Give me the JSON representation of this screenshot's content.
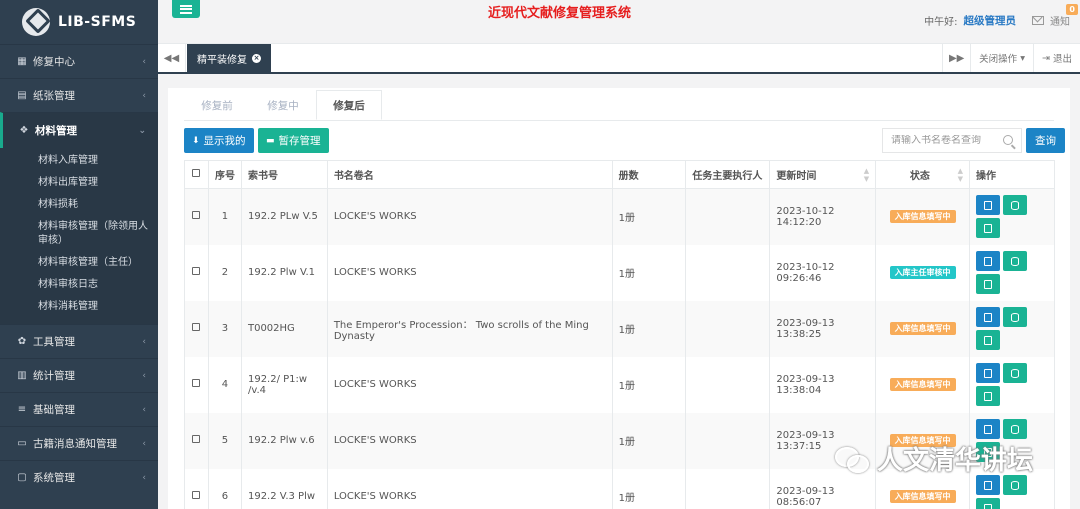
{
  "app": {
    "logo_text": "LIB-SFMS",
    "system_title": "近现代文献修复管理系统"
  },
  "header": {
    "greeting": "中午好:",
    "user_name": "超级管理员",
    "notify_label": "通知",
    "notify_count": "0"
  },
  "sidebar": {
    "items": [
      {
        "label": "修复中心",
        "icon": "briefcase-icon"
      },
      {
        "label": "纸张管理",
        "icon": "file-icon"
      },
      {
        "label": "材料管理",
        "icon": "cubes-icon",
        "active": true
      },
      {
        "label": "工具管理",
        "icon": "gear-icon"
      },
      {
        "label": "统计管理",
        "icon": "bar-chart-icon"
      },
      {
        "label": "基础管理",
        "icon": "list-icon"
      },
      {
        "label": "古籍消息通知管理",
        "icon": "laptop-icon"
      },
      {
        "label": "系统管理",
        "icon": "monitor-icon"
      }
    ],
    "sub_items": [
      "材料入库管理",
      "材料出库管理",
      "材料损耗",
      "材料审核管理（除领用人审核）",
      "材料审核管理（主任）",
      "材料审核日志",
      "材料消耗管理"
    ]
  },
  "tabbar": {
    "current_tab": "精平装修复",
    "close_ops": "关闭操作",
    "logout": "退出"
  },
  "subtabs": [
    "修复前",
    "修复中",
    "修复后"
  ],
  "toolbar": {
    "show_mine": "显示我的",
    "temp_manage": "暂存管理",
    "search_placeholder": "请输入书名卷名查询",
    "search_button": "查询"
  },
  "table": {
    "headers": [
      "序号",
      "索书号",
      "书名卷名",
      "册数",
      "任务主要执行人",
      "更新时间",
      "状态",
      "操作"
    ],
    "rows": [
      {
        "no": "1",
        "call": "192.2 PLw V.5",
        "title": "LOCKE'S WORKS",
        "vols": "1册",
        "exec": "",
        "date": "2023-10-12",
        "time": "14:12:20",
        "status": "入库信息填写中",
        "color": "orange"
      },
      {
        "no": "2",
        "call": "192.2 Plw V.1",
        "title": "LOCKE'S WORKS",
        "vols": "1册",
        "exec": "",
        "date": "2023-10-12",
        "time": "09:26:46",
        "status": "入库主任审核中",
        "color": "cyan"
      },
      {
        "no": "3",
        "call": "T0002HG",
        "title": "The Emperor's Procession： Two scrolls of the Ming Dynasty",
        "vols": "1册",
        "exec": "",
        "date": "2023-09-13",
        "time": "13:38:25",
        "status": "入库信息填写中",
        "color": "orange"
      },
      {
        "no": "4",
        "call": "192.2/ P1:w /v.4",
        "title": "LOCKE'S WORKS",
        "vols": "1册",
        "exec": "",
        "date": "2023-09-13",
        "time": "13:38:04",
        "status": "入库信息填写中",
        "color": "orange"
      },
      {
        "no": "5",
        "call": "192.2 Plw v.6",
        "title": "LOCKE'S WORKS",
        "vols": "1册",
        "exec": "",
        "date": "2023-09-13",
        "time": "13:37:15",
        "status": "入库信息填写中",
        "color": "orange"
      },
      {
        "no": "6",
        "call": "192.2 V.3 Plw",
        "title": "LOCKE'S WORKS",
        "vols": "1册",
        "exec": "",
        "date": "2023-09-13",
        "time": "08:56:07",
        "status": "入库信息填写中",
        "color": "orange"
      }
    ]
  },
  "watermark": "人文清华讲坛",
  "colors": {
    "sidebar": "#2f4050",
    "accent_green": "#1ab394",
    "accent_blue": "#1c84c6",
    "status_orange": "#f8ac59",
    "status_cyan": "#23c6c8",
    "title_red": "#e61e1e"
  }
}
